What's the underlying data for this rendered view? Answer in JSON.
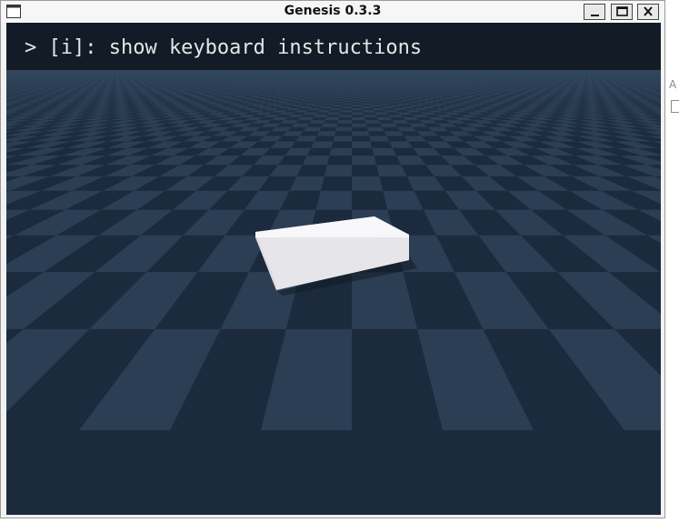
{
  "window": {
    "title": "Genesis 0.3.3",
    "controls": {
      "minimize_icon": "minimize-icon",
      "maximize_icon": "maximize-icon",
      "close_icon": "close-icon"
    }
  },
  "viewer": {
    "overlay_text": "> [i]: show keyboard instructions",
    "colors": {
      "tile_light": "#2c3e54",
      "tile_dark": "#1b2a3d",
      "overlay_bg": "#121b26",
      "box_top": "#f4f4f6",
      "box_side": "#e4e4e8"
    }
  },
  "background": {
    "fragment_letter": "A"
  }
}
